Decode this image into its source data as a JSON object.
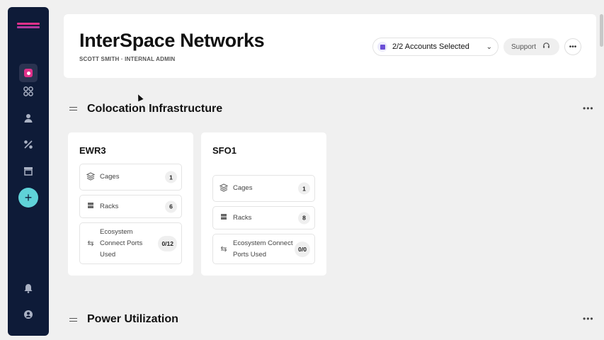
{
  "app": {
    "title": "InterSpace Networks",
    "subtitle": "SCOTT SMITH · INTERNAL ADMIN"
  },
  "header": {
    "accounts_label": "2/2 Accounts Selected",
    "support_label": "Support",
    "more": "•••"
  },
  "sidebar": {
    "icons": [
      "dashboard-icon",
      "apps-icon",
      "user-icon",
      "connections-icon",
      "store-icon",
      "add-icon",
      "bell-icon",
      "account-icon"
    ],
    "add_label": "+"
  },
  "sections": {
    "colocation": {
      "title": "Colocation Infrastructure",
      "more": "•••"
    },
    "power": {
      "title": "Power Utilization",
      "more": "•••"
    }
  },
  "sites": [
    {
      "name": "EWR3",
      "cages_label": "Cages",
      "cages": "1",
      "racks_label": "Racks",
      "racks": "6",
      "ports_label_l1": "Ecosystem",
      "ports_label_l2": "Connect Ports",
      "ports_label_l3": "Used",
      "ports": "0/12"
    },
    {
      "name": "SFO1",
      "cages_label": "Cages",
      "cages": "1",
      "racks_label": "Racks",
      "racks": "8",
      "ports_label_l1": "Ecosystem Connect",
      "ports_label_l2": "Ports Used",
      "ports": "0/0"
    }
  ],
  "colors": {
    "sidebar_bg": "#0e1b38",
    "brand_pink": "#e0308a",
    "add_button": "#5fd2d8",
    "account_icon": "#6b4fd6"
  }
}
